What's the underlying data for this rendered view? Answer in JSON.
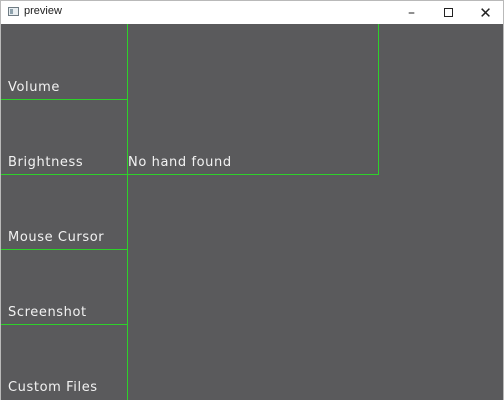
{
  "window": {
    "title": "preview",
    "controls": {
      "minimize": "–",
      "close": "✕"
    }
  },
  "preview": {
    "menu_items": [
      {
        "label": "Volume"
      },
      {
        "label": "Brightness"
      },
      {
        "label": "Mouse Cursor"
      },
      {
        "label": "Screenshot"
      },
      {
        "label": "Custom Files"
      }
    ],
    "status": "No hand found",
    "colors": {
      "overlay_line": "#2ed12a",
      "label_text": "#f2f2f2",
      "background": "#5a5a5c"
    }
  }
}
